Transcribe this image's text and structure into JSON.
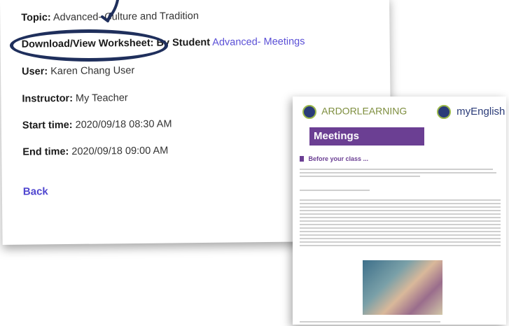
{
  "details": {
    "topic_label": "Topic:",
    "topic_value": "Advanced- Culture and Tradition",
    "download_label": "Download/View Worksheet:",
    "download_by": "By Student",
    "download_link": "Advanced- Meetings",
    "user_label": "User:",
    "user_value": "Karen Chang User",
    "instructor_label": "Instructor:",
    "instructor_value": "My Teacher",
    "start_label": "Start time:",
    "start_value": "2020/09/18 08:30 AM",
    "end_label": "End time:",
    "end_value": "2020/09/18 09:00 AM",
    "back_label": "Back"
  },
  "worksheet": {
    "brand_left": "ARDORLEARNING",
    "brand_right": "myEnglish",
    "title": "Meetings",
    "section": "Before your class ..."
  },
  "colors": {
    "link": "#5a4fd6",
    "annotation": "#1f2f5c",
    "purple": "#6b3f93"
  }
}
